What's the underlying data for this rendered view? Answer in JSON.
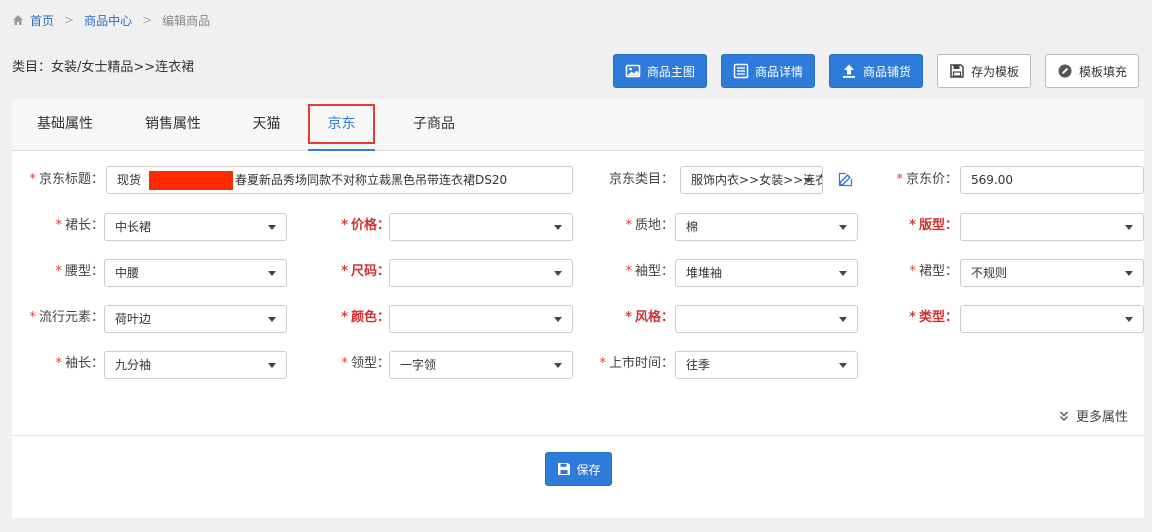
{
  "breadcrumb": {
    "home": "首页",
    "center": "商品中心",
    "current": "编辑商品",
    "sep": ">"
  },
  "category_path": "类目：女装/女士精品>>连衣裙",
  "toolbar": {
    "main_image": "商品主图",
    "details": "商品详情",
    "list": "商品铺货",
    "save_template": "存为模板",
    "fill_template": "模板填充"
  },
  "tabs": [
    "基础属性",
    "销售属性",
    "天猫",
    "京东",
    "子商品"
  ],
  "active_tab": "京东",
  "form": {
    "jd_title_label": "京东标题：",
    "jd_title_prefix": "现货",
    "jd_title_suffix": "春夏新品秀场同款不对称立裁黑色吊带连衣裙DS20",
    "jd_category_label": "京东类目：",
    "jd_category_value": "服饰内衣>>女装>>连衣裙",
    "jd_price_label": "京东价：",
    "jd_price_value": "569.00",
    "skirt_length_label": "裙长：",
    "skirt_length_value": "中长裙",
    "price_label": "价格：",
    "price_value": "",
    "material_label": "质地：",
    "material_value": "棉",
    "fit_label": "版型：",
    "fit_value": "",
    "waist_label": "腰型：",
    "waist_value": "中腰",
    "size_label": "尺码：",
    "size_value": "",
    "sleeve_type_label": "袖型：",
    "sleeve_type_value": "堆堆袖",
    "skirt_type_label": "裙型：",
    "skirt_type_value": "不规则",
    "trend_label": "流行元素：",
    "trend_value": "荷叶边",
    "color_label": "颜色：",
    "color_value": "",
    "style_label": "风格：",
    "style_value": "",
    "kind_label": "类型：",
    "kind_value": "",
    "sleeve_length_label": "袖长：",
    "sleeve_length_value": "九分袖",
    "collar_label": "领型：",
    "collar_value": "一字领",
    "launch_label": "上市时间：",
    "launch_value": "往季"
  },
  "required_mark": "*",
  "more_attrs": "更多属性",
  "save": "保存",
  "colors": {
    "primary": "#2f7bd9",
    "required": "#e53935",
    "redaction": "#ff2a00"
  }
}
